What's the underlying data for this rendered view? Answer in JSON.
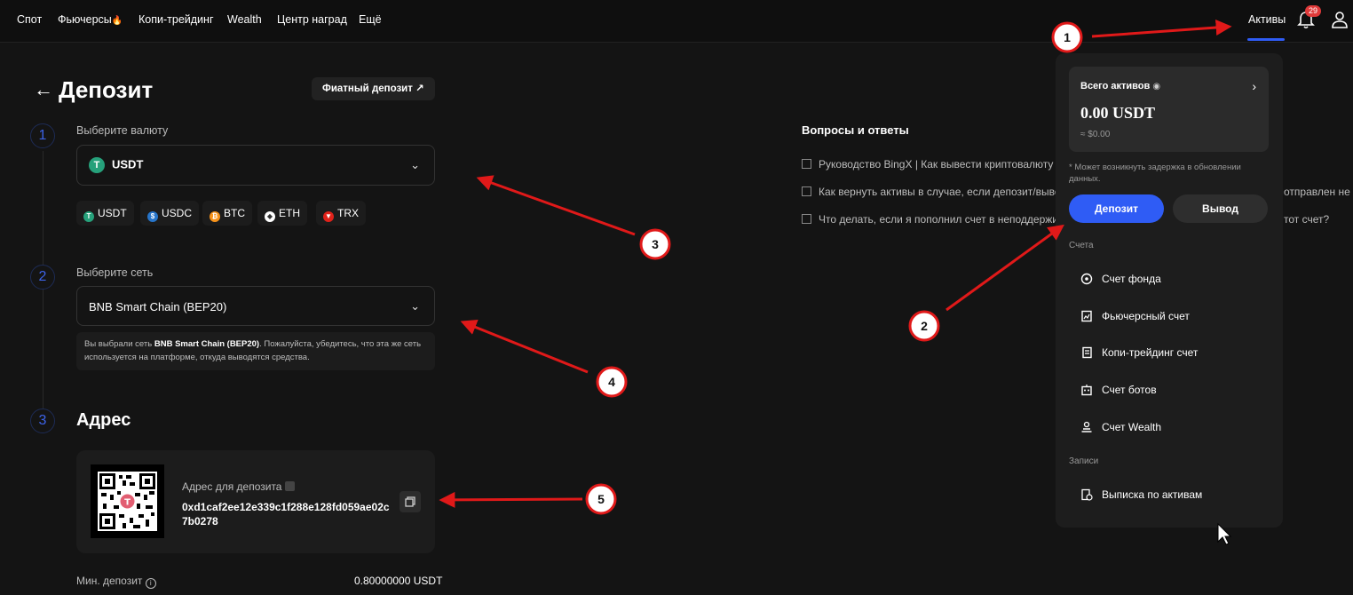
{
  "nav": {
    "items": [
      "Спот",
      "Фьючерсы",
      "Копи-трейдинг",
      "Wealth",
      "Центр наград",
      "Ещё"
    ],
    "fire": "🔥",
    "assets": "Активы",
    "badge": "29"
  },
  "page": {
    "title": "Депозит",
    "fiat_button": "Фиатный депозит ↗"
  },
  "steps": [
    "1",
    "2",
    "3"
  ],
  "currency": {
    "label": "Выберите валюту",
    "selected": "USDT",
    "quick": [
      "USDT",
      "USDC",
      "BTC",
      "ETH",
      "TRX"
    ]
  },
  "network": {
    "label": "Выберите сеть",
    "selected": "BNB Smart Chain (BEP20)",
    "notice_prefix": "Вы выбрали сеть ",
    "notice_bold": "BNB Smart Chain (BEP20)",
    "notice_suffix": ". Пожалуйста, убедитесь, что эта же сеть используется на платформе, откуда выводятся средства."
  },
  "address": {
    "heading": "Адрес",
    "label": "Адрес для депозита",
    "value": "0xd1caf2ee12e339c1f288e128fd059ae02c7b0278"
  },
  "min_deposit": {
    "label": "Мин. депозит",
    "value": "0.80000000 USDT"
  },
  "faq": {
    "title": "Вопросы и ответы",
    "items": [
      "Руководство BingX | Как вывести криптовалюту с",
      "Как вернуть активы в случае, если депозит/вывод",
      "Что делать, если я пополнил счет в неподдержив"
    ],
    "overflow": [
      "отправлен не",
      "тот счет?"
    ]
  },
  "assets_panel": {
    "total_label": "Всего активов",
    "total_value": "0.00 USDT",
    "total_usd": "≈ $0.00",
    "delay_note": "* Может возникнуть задержка в обновлении данных.",
    "deposit": "Депозит",
    "withdraw": "Вывод",
    "accounts_label": "Счета",
    "accounts": [
      "Счет фонда",
      "Фьючерсный счет",
      "Копи-трейдинг счет",
      "Счет ботов",
      "Счет Wealth"
    ],
    "records_label": "Записи",
    "records": [
      "Выписка по активам"
    ]
  },
  "annotations": [
    "1",
    "2",
    "3",
    "4",
    "5"
  ],
  "colors": {
    "accent": "#2f5cf5",
    "tether": "#26a17b",
    "annotation": "#e01919"
  }
}
